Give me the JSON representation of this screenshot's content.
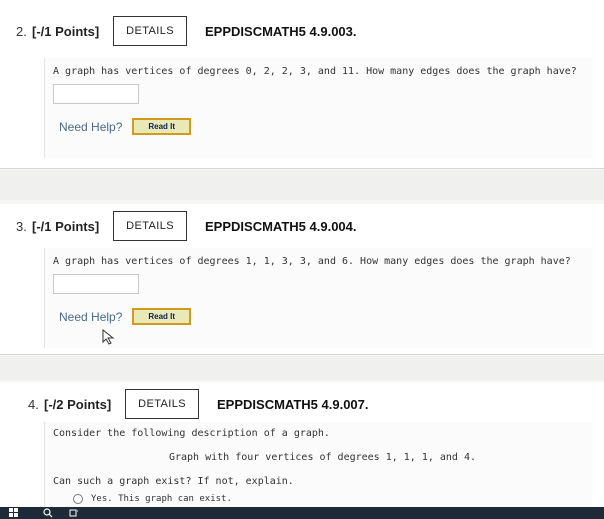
{
  "questions": [
    {
      "number": "2.",
      "points": "[-/1 Points]",
      "details_label": "DETAILS",
      "code": "EPPDISCMATH5 4.9.003.",
      "text": "A graph has vertices of degrees 0, 2, 2, 3, and 11. How many edges does the graph have?",
      "answer_value": "",
      "need_help": "Need Help?",
      "read_it": "Read It"
    },
    {
      "number": "3.",
      "points": "[-/1 Points]",
      "details_label": "DETAILS",
      "code": "EPPDISCMATH5 4.9.004.",
      "text": "A graph has vertices of degrees 1, 1, 3, 3, and 6. How many edges does the graph have?",
      "answer_value": "",
      "need_help": "Need Help?",
      "read_it": "Read It"
    },
    {
      "number": "4.",
      "points": "[-/2 Points]",
      "details_label": "DETAILS",
      "code": "EPPDISCMATH5 4.9.007.",
      "intro": "Consider the following description of a graph.",
      "description": "Graph with four vertices of degrees 1, 1, 1, and 4.",
      "prompt": "Can such a graph exist? If not, explain.",
      "option_1": "Yes. This graph can exist."
    }
  ],
  "taskbar": {
    "icons": [
      "windows-icon",
      "search-icon",
      "task-view-icon"
    ]
  },
  "colors": {
    "accent_link": "#4a6a8a",
    "read_it_border": "#d09a1e",
    "read_it_bg": "#e9e9b8"
  }
}
